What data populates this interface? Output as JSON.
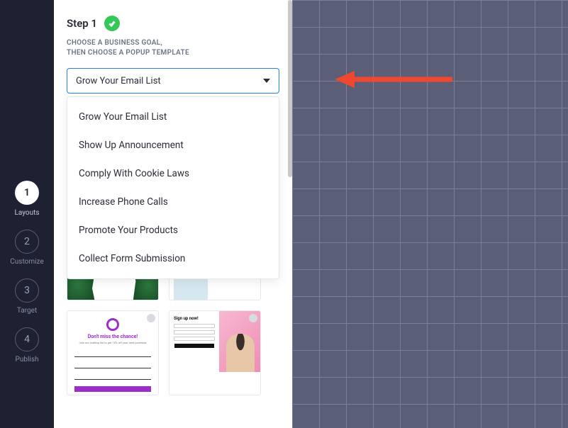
{
  "nav": {
    "steps": [
      {
        "num": "1",
        "label": "Layouts",
        "active": true
      },
      {
        "num": "2",
        "label": "Customize",
        "active": false
      },
      {
        "num": "3",
        "label": "Target",
        "active": false
      },
      {
        "num": "4",
        "label": "Publish",
        "active": false
      }
    ]
  },
  "panel": {
    "step_title": "Step 1",
    "subtitle_line1": "CHOOSE A BUSINESS GOAL,",
    "subtitle_line2": "THEN CHOOSE A POPUP TEMPLATE",
    "select": {
      "selected": "Grow Your Email List",
      "options": [
        "Grow Your Email List",
        "Show Up Announcement",
        "Comply With Cookie Laws",
        "Increase Phone Calls",
        "Promote Your Products",
        "Collect Form Submission"
      ]
    },
    "templates": {
      "tpl3_title": "Don't miss the chance!",
      "tpl3_sub": "Join our mailing list to get 15% off your next purchase",
      "tpl4_title": "Sign up now!"
    }
  },
  "icons": {
    "check": "check-icon",
    "caret": "caret-down-icon"
  },
  "colors": {
    "accent_blue": "#2a7de1",
    "success_green": "#34c759",
    "purple": "#9b2dc9",
    "arrow_red": "#f0472f"
  }
}
